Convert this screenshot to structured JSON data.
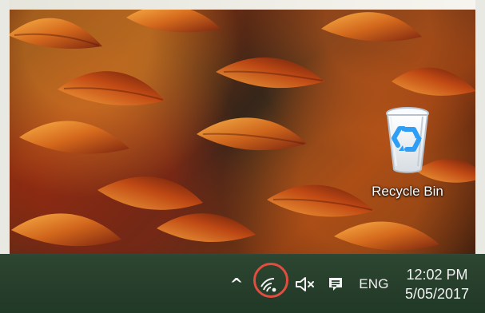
{
  "desktop": {
    "icons": [
      {
        "label": "Recycle Bin",
        "icon_name": "recycle-bin-icon"
      }
    ]
  },
  "taskbar": {
    "tray": {
      "hidden_icons_symbol": "^",
      "network_icon_name": "wifi-icon",
      "volume_icon_name": "volume-muted-icon",
      "action_center_icon_name": "action-center-icon",
      "language_label": "ENG",
      "time": "12:02 PM",
      "date": "5/05/2017",
      "highlight_color": "#e14d3e"
    }
  },
  "theme": {
    "taskbar_color": "#2d4631",
    "text_color": "#f2f2f2"
  }
}
